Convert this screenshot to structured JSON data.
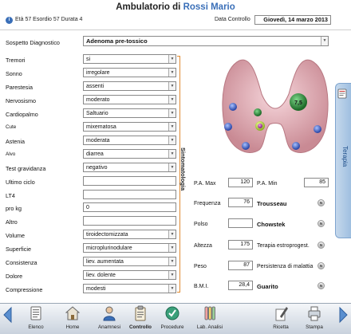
{
  "header": {
    "title_prefix": "Ambulatorio di ",
    "patient_name": "Rossi Mario",
    "info_icon": "info-icon",
    "patient_info": "Età 57 Esordio 57 Durata 4",
    "date_label": "Data Controllo",
    "date_value": "Giovedì, 14 marzo 2013"
  },
  "diagnosis": {
    "label": "Sospetto Diagnostico",
    "value": "Adenoma pre-tossico"
  },
  "section_label": "Sintomatologia",
  "symptoms": [
    {
      "label": "Tremori",
      "value": "si",
      "dropdown": true
    },
    {
      "label": "Sonno",
      "value": "irregolare",
      "dropdown": true
    },
    {
      "label": "Parestesia",
      "value": "assenti",
      "dropdown": true
    },
    {
      "label": "Nervosismo",
      "value": "moderato",
      "dropdown": true
    },
    {
      "label": "Cardiopalmo",
      "value": "Saltuario",
      "dropdown": true
    },
    {
      "label": "Cute",
      "value": "mixematosa",
      "dropdown": true
    },
    {
      "label": "Astenia",
      "value": "moderata",
      "dropdown": true
    },
    {
      "label": "Alvo",
      "value": "diarrea",
      "dropdown": true
    },
    {
      "label": "Test gravidanza",
      "value": "negativo",
      "dropdown": true
    },
    {
      "label": "Ultimo ciclo",
      "value": "",
      "dropdown": false
    },
    {
      "label": "LT4",
      "value": "",
      "dropdown": false
    },
    {
      "label": "pro kg",
      "value": "0",
      "dropdown": false
    },
    {
      "label": "Altro",
      "value": "",
      "dropdown": false
    },
    {
      "label": "Volume",
      "value": "tiroidectomizzata",
      "dropdown": true
    },
    {
      "label": "Superficie",
      "value": "microplurinodulare",
      "dropdown": true
    },
    {
      "label": "Consistenza",
      "value": "liev. aumentata",
      "dropdown": true
    },
    {
      "label": "Dolore",
      "value": "liev. dolente",
      "dropdown": true
    },
    {
      "label": "Compressione",
      "value": "modesti",
      "dropdown": true
    }
  ],
  "thyroid": {
    "nodule_large_label": "7,5",
    "colors": {
      "lobe": "#e8b8c0",
      "nodule_green": "#2e8b3a",
      "nodule_blue": "#3a5fc8",
      "nodule_magenta": "#c040c0"
    }
  },
  "measurements": {
    "pa_max_label": "P.A. Max",
    "pa_max": "120",
    "pa_min_label": "P.A. Min",
    "pa_min": "85",
    "frequenza_label": "Frequenza",
    "frequenza": "76",
    "trousseau_label": "Trousseau",
    "polso_label": "Polso",
    "polso": "",
    "chowstek_label": "Chowstek",
    "altezza_label": "Altezza",
    "altezza": "175",
    "terapia_estro_label": "Terapia estroprogest.",
    "peso_label": "Peso",
    "peso": "87",
    "persistenza_label": "Persistenza di malattia",
    "bmi_label": "B.M.I.",
    "bmi": "28,4",
    "guarito_label": "Guarito",
    "badge_text": "N"
  },
  "side_tab": {
    "label": "Terapia"
  },
  "toolbar": {
    "buttons": [
      {
        "label": "Elenco",
        "icon": "list-icon"
      },
      {
        "label": "Home",
        "icon": "home-icon"
      },
      {
        "label": "Anamnesi",
        "icon": "person-icon"
      },
      {
        "label": "Controllo",
        "icon": "clipboard-icon",
        "active": true
      },
      {
        "label": "Procedure",
        "icon": "procedure-icon"
      },
      {
        "label": "Lab. Analisi",
        "icon": "test-tubes-icon"
      },
      {
        "label": "Ricetta",
        "icon": "pen-icon"
      },
      {
        "label": "Stampa",
        "icon": "printer-icon"
      }
    ]
  }
}
